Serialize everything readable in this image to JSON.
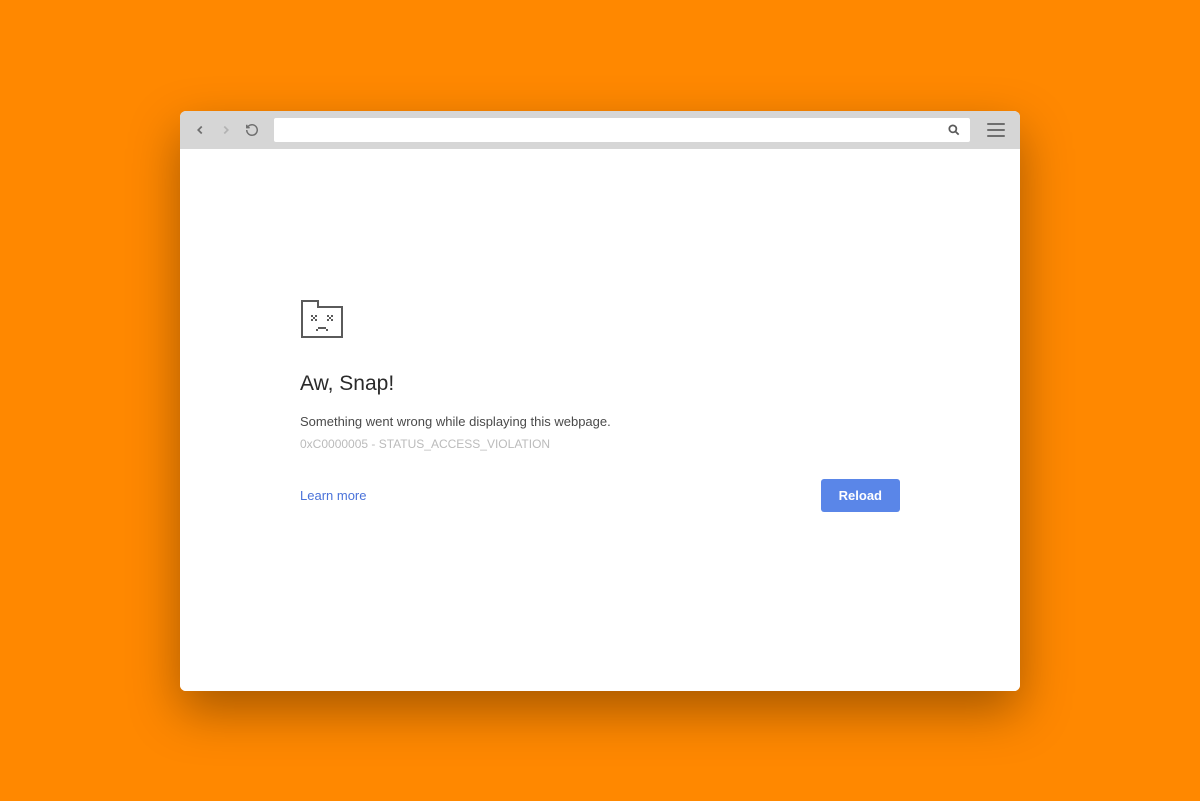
{
  "toolbar": {
    "address_value": ""
  },
  "error": {
    "title": "Aw, Snap!",
    "message": "Something went wrong while displaying this webpage.",
    "code": "0xC0000005 - STATUS_ACCESS_VIOLATION",
    "learn_more_label": "Learn more",
    "reload_label": "Reload"
  },
  "colors": {
    "accent": "#5a86e8",
    "background": "#ff8800"
  }
}
